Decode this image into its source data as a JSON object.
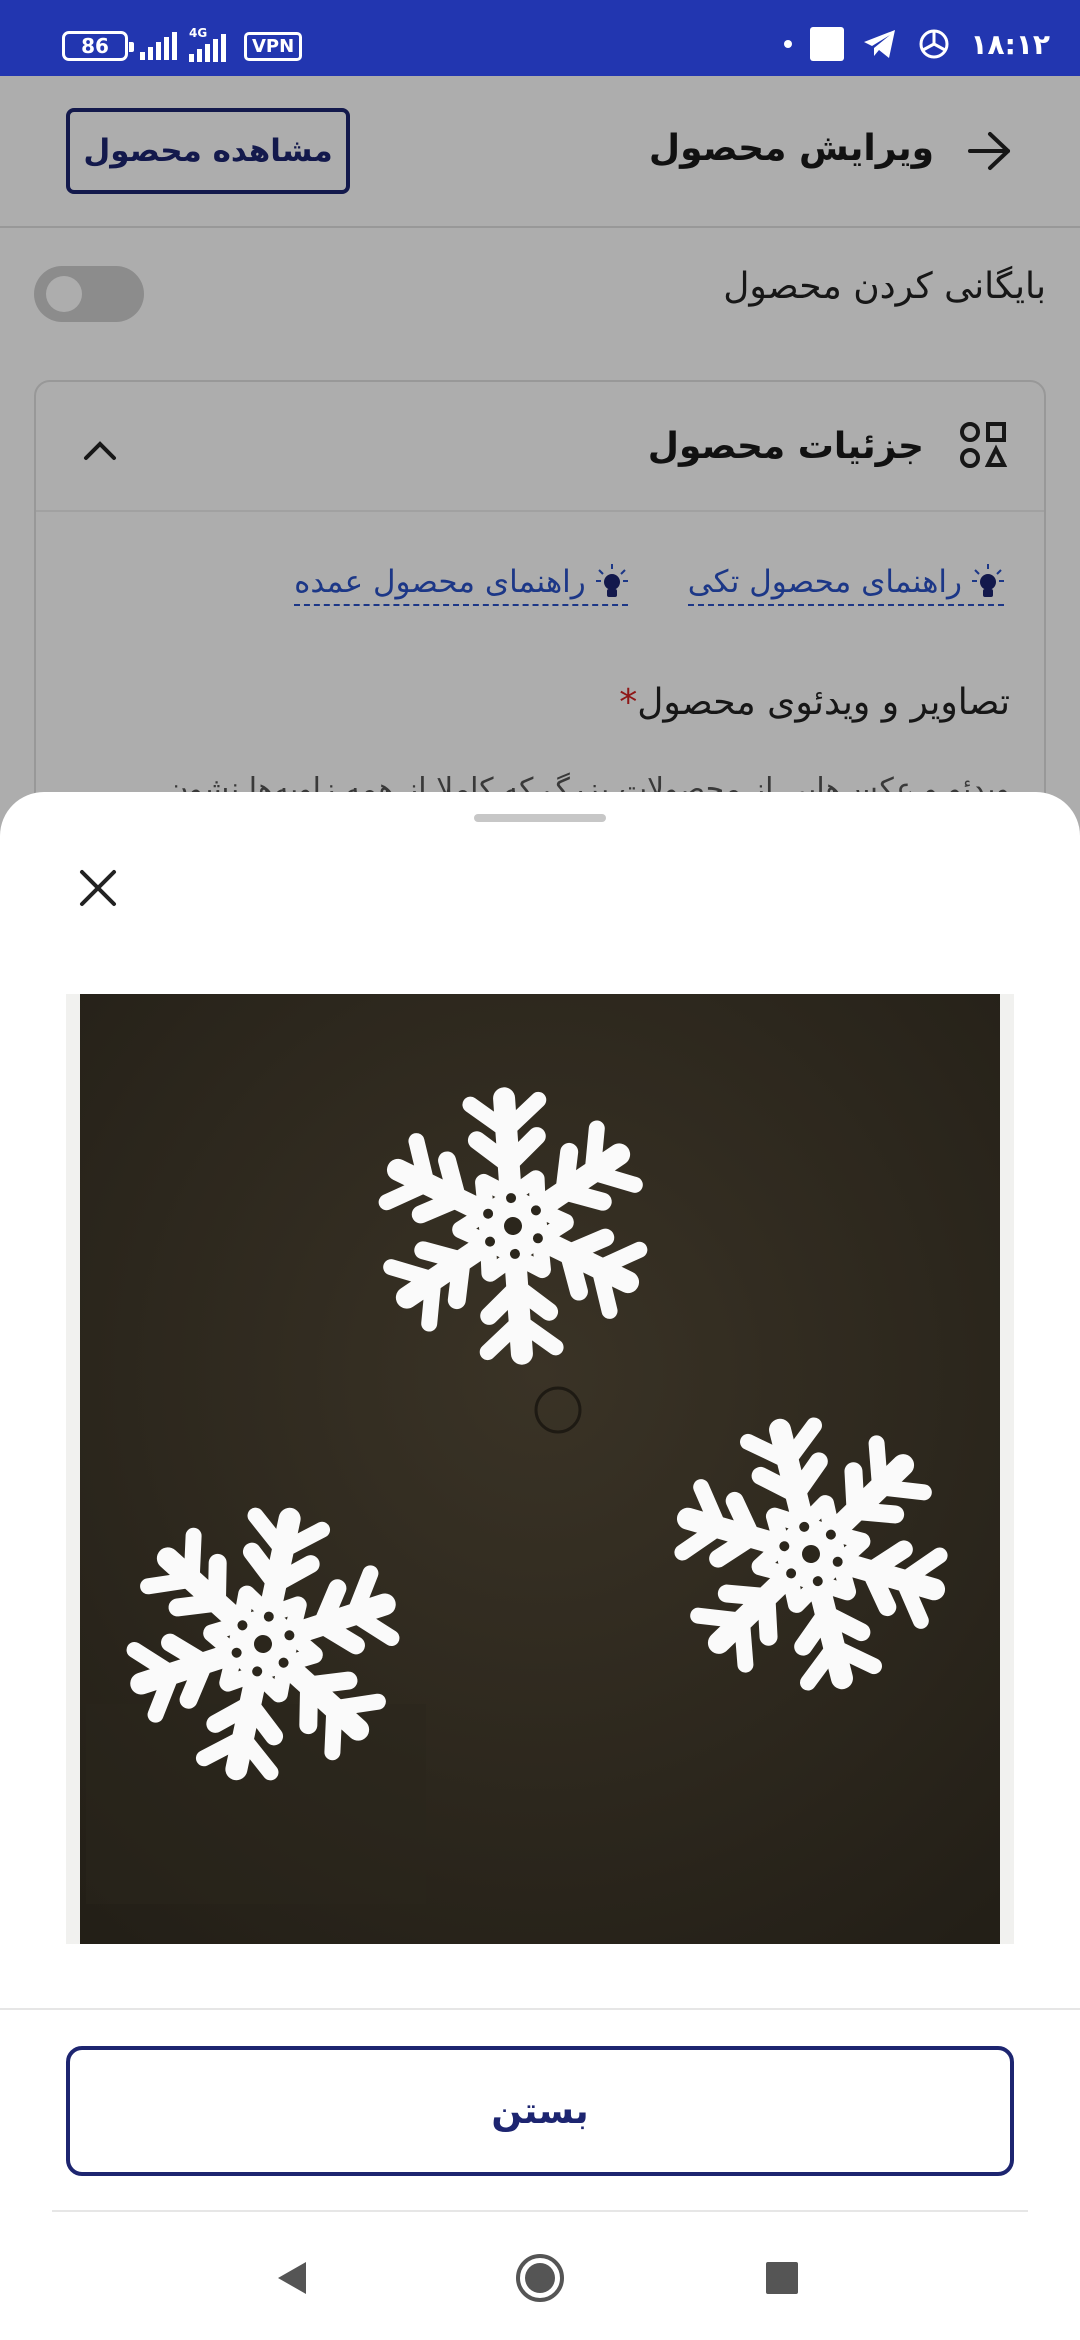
{
  "status_bar": {
    "battery": "86",
    "network_type": "4G",
    "vpn": "VPN",
    "time": "۱۸:۱۲",
    "icons": [
      "battery-icon",
      "signal-icon",
      "vpn-icon",
      "telegram-icon",
      "openai-icon"
    ]
  },
  "header": {
    "title": "ویرایش محصول",
    "view_button": "مشاهده محصول"
  },
  "archive": {
    "label": "بایگانی کردن محصول",
    "enabled": false
  },
  "details_card": {
    "title": "جزئیات محصول",
    "guides": [
      "راهنمای محصول تکی",
      "راهنمای محصول عمده"
    ],
    "media_title": "تصاویر و ویدئوی محصول",
    "required_mark": "*",
    "media_description": "ویدئو و عکس‌هایی از محصولات بزرگ که کاملا از همه زاویه‌ها نشون"
  },
  "sheet": {
    "image_alt": "three white snowflake ornaments on a dark background",
    "close_button": "بستن"
  },
  "colors": {
    "status_bar": "#2236b0",
    "primary_navy": "#1d2570",
    "link_blue": "#2a52c8",
    "required_red": "#d32222"
  }
}
